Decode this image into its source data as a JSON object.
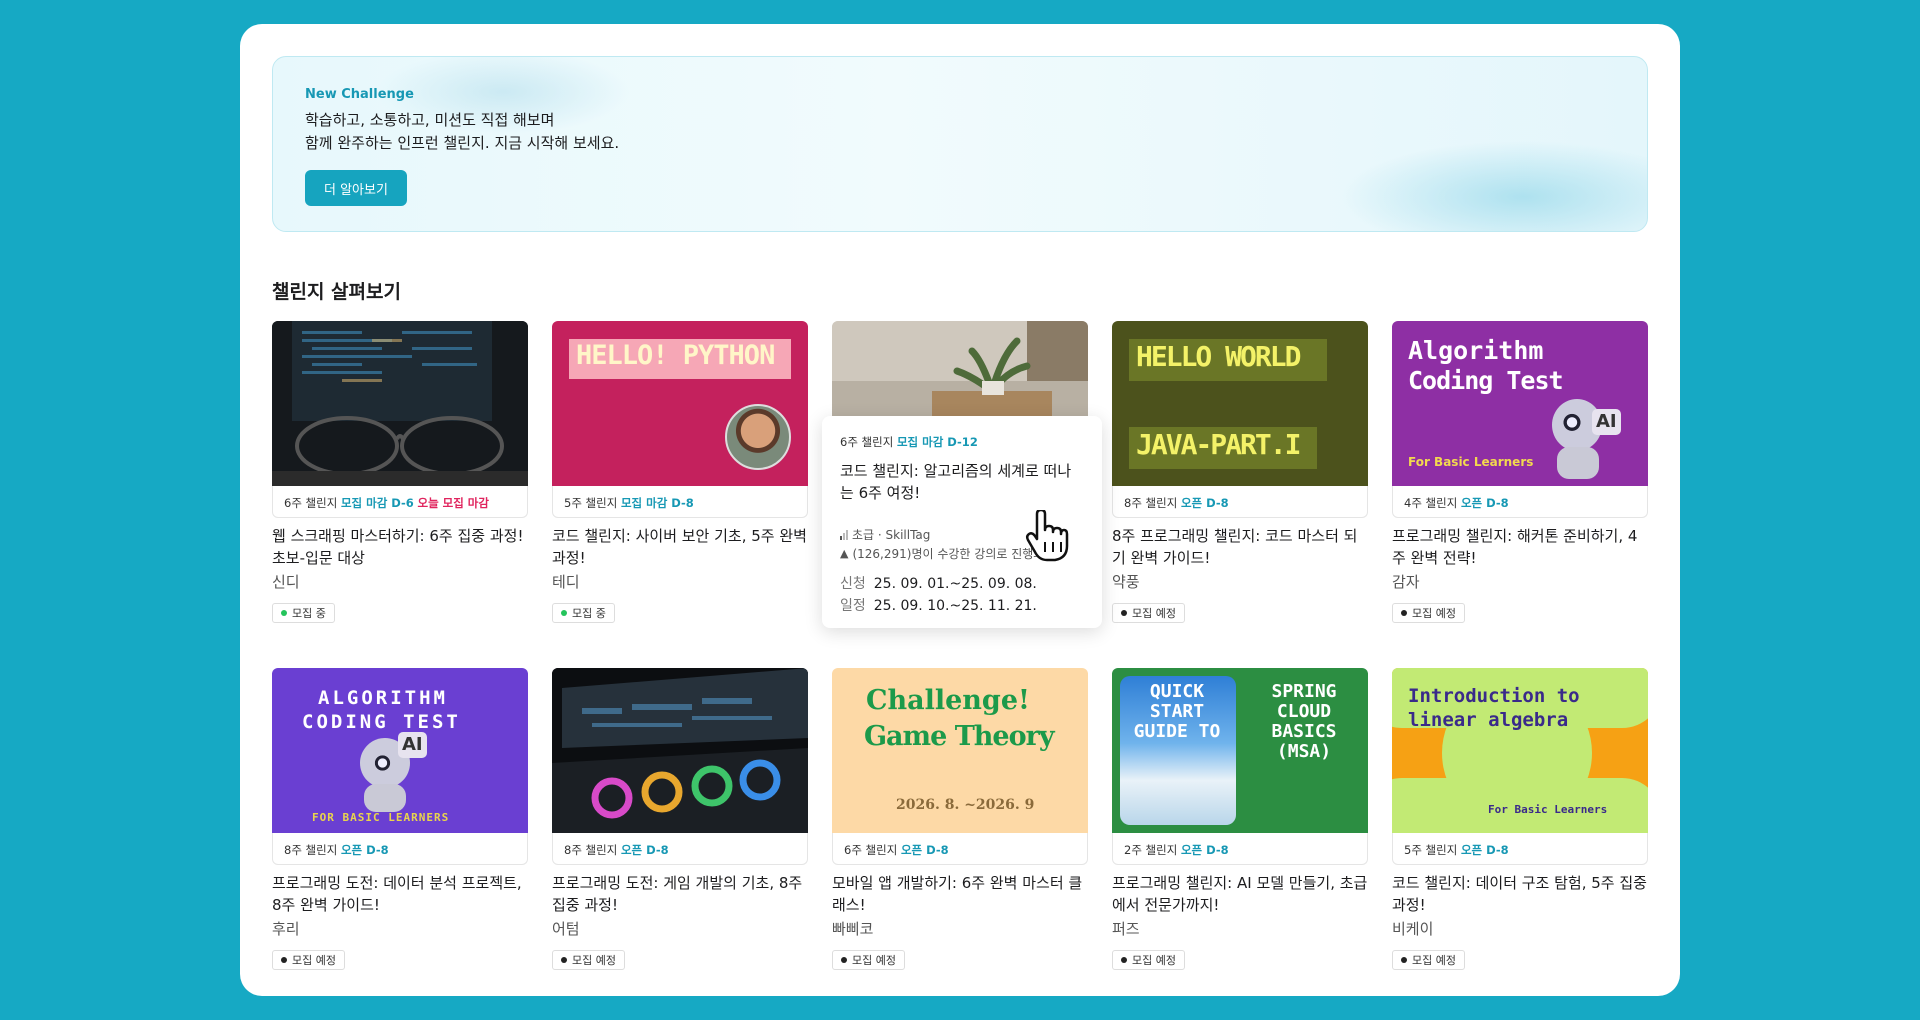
{
  "banner": {
    "eyebrow": "New Challenge",
    "line1": "학습하고, 소통하고, 미션도 직접 해보며",
    "line2": "함께 완주하는 인프런 챌린지. 지금 시작해 보세요.",
    "button": "더 알아보기"
  },
  "section_title": "챌린지 살펴보기",
  "cards": [
    {
      "weeks": "6주 챌린지",
      "status": "모집 마감 D-6",
      "extra": "오늘 모집 마감",
      "title": "웹 스크래핑 마스터하기: 6주 집중 과정! 초보-입문 대상",
      "author": "신디",
      "badge": "모집 중"
    },
    {
      "weeks": "5주 챌린지",
      "status": "모집 마감 D-8",
      "title": "코드 챌린지: 사이버 보안 기초, 5주 완벽 과정!",
      "author": "테디",
      "badge": "모집 중",
      "thumb_text": "HELLO! PYTHON"
    },
    {
      "weeks": "6주 챌린지",
      "status": "모집 마감 D-12",
      "title": "코드 챌린지: 알고리즘의 세계로 떠나는 6주 여정!"
    },
    {
      "weeks": "8주 챌린지",
      "status": "오픈 D-8",
      "title": "8주 프로그래밍 챌린지: 코드 마스터 되기 완벽 가이드!",
      "author": "약풍",
      "badge": "모집 예정",
      "thumb_text1": "HELLO WORLD",
      "thumb_text2": "JAVA-PART.I"
    },
    {
      "weeks": "4주 챌린지",
      "status": "오픈 D-8",
      "title": "프로그래밍 챌린지: 해커톤 준비하기, 4주 완벽 전략!",
      "author": "감자",
      "badge": "모집 예정",
      "thumb_text1": "Algorithm",
      "thumb_text2": "Coding Test",
      "thumb_text3": "For Basic Learners",
      "ai": "AI"
    },
    {
      "weeks": "8주 챌린지",
      "status": "오픈 D-8",
      "title": "프로그래밍 도전: 데이터 분석 프로젝트, 8주 완벽 가이드!",
      "author": "후리",
      "badge": "모집 예정",
      "thumb_text1": "ALGORITHM",
      "thumb_text2": "CODING TEST",
      "thumb_text3": "FOR BASIC LEARNERS",
      "ai": "AI"
    },
    {
      "weeks": "8주 챌린지",
      "status": "오픈 D-8",
      "title": "프로그래밍 도전: 게임 개발의 기초, 8주 집중 과정!",
      "author": "어텀",
      "badge": "모집 예정"
    },
    {
      "weeks": "6주 챌린지",
      "status": "오픈 D-8",
      "title": "모바일 앱 개발하기: 6주 완벽 마스터 클래스!",
      "author": "빠삐코",
      "badge": "모집 예정",
      "thumb_text1": "Challenge!",
      "thumb_text2": "Game Theory",
      "thumb_text3": "2026. 8. ~2026. 9"
    },
    {
      "weeks": "2주 챌린지",
      "status": "오픈 D-8",
      "title": "프로그래밍 챌린지: AI 모델 만들기, 초급에서 전문가까지!",
      "author": "퍼즈",
      "badge": "모집 예정",
      "thumb_text1": "QUICK START GUIDE TO",
      "thumb_text2": "SPRING CLOUD BASICS (MSA)"
    },
    {
      "weeks": "5주 챌린지",
      "status": "오픈 D-8",
      "title": "코드 챌린지: 데이터 구조 탐험, 5주 집중 과정!",
      "author": "비케이",
      "badge": "모집 예정",
      "thumb_text1": "Introduction to",
      "thumb_text2": "linear algebra",
      "thumb_text3": "For Basic Learners"
    }
  ],
  "popup": {
    "level": "초급 · SkillTag",
    "students": "(126,291)명이 수강한 강의로 진행돼요",
    "apply_label": "신청",
    "apply_dates": "25. 09. 01.~25. 09. 08.",
    "schedule_label": "일정",
    "schedule_dates": "25. 09. 10.~25. 11. 21."
  }
}
